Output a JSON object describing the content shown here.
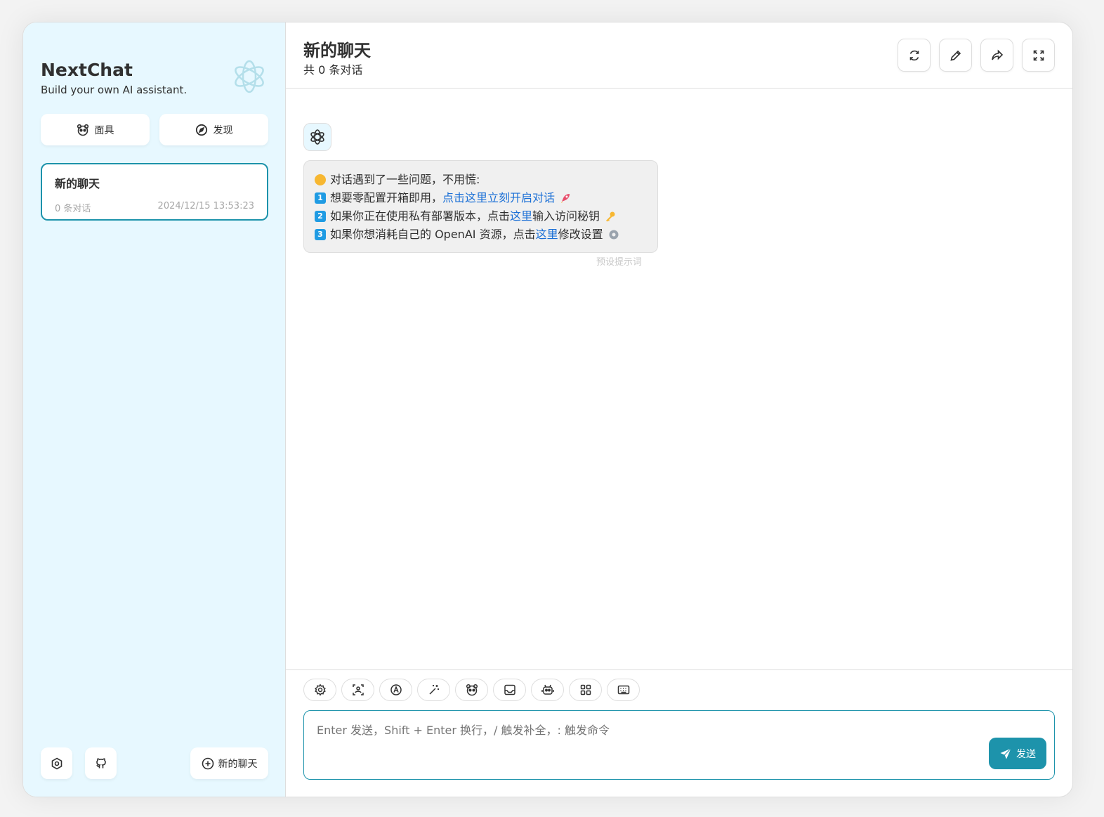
{
  "sidebar": {
    "title": "NextChat",
    "subtitle": "Build your own AI assistant.",
    "mask_label": "面具",
    "discover_label": "发现",
    "chats": [
      {
        "title": "新的聊天",
        "count": "0 条对话",
        "time": "2024/12/15 13:53:23"
      }
    ],
    "new_chat_label": "新的聊天"
  },
  "header": {
    "title": "新的聊天",
    "subtitle": "共 0 条对话"
  },
  "message": {
    "line1": "对话遇到了一些问题，不用慌:",
    "line2_pre": "想要零配置开箱即用，",
    "line2_link": "点击这里立刻开启对话",
    "line3_pre": "如果你正在使用私有部署版本，点击",
    "line3_link": "这里",
    "line3_post": "输入访问秘钥",
    "line4_pre": "如果你想消耗自己的 OpenAI 资源，点击",
    "line4_link": "这里",
    "line4_post": "修改设置",
    "preset_note": "预设提示词",
    "nums": [
      "1",
      "2",
      "3"
    ]
  },
  "input": {
    "placeholder": "Enter 发送，Shift + Enter 换行，/ 触发补全，: 触发命令",
    "send_label": "发送"
  },
  "colors": {
    "accent": "#1d93ab",
    "sidebar_bg": "#e7f8ff",
    "link": "#1a6fd6"
  }
}
